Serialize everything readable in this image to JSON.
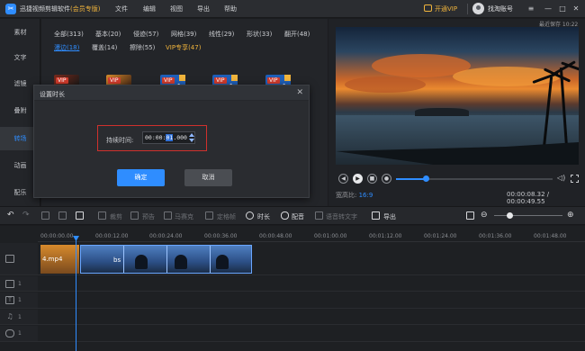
{
  "app": {
    "title_main": "迅捷视频剪辑软件",
    "title_edition": "(会员专版)",
    "menu": [
      "文件",
      "编辑",
      "视图",
      "导出",
      "帮助"
    ],
    "open_vip": "开通VIP",
    "username": "找淘账号"
  },
  "leftnav": {
    "items": [
      {
        "label": "素材"
      },
      {
        "label": "文字"
      },
      {
        "label": "滤镜"
      },
      {
        "label": "叠附"
      },
      {
        "label": "转场"
      },
      {
        "label": "动画"
      },
      {
        "label": "配乐"
      }
    ],
    "active": "转场"
  },
  "media": {
    "categories_row1": [
      "全部(313)",
      "基本(20)",
      "侵迹(57)",
      "网格(39)",
      "线性(29)",
      "形状(33)",
      "翻开(48)"
    ],
    "categories_row2": [
      "漫边(18)",
      "覆盖(14)",
      "擦除(55)",
      "VIP专享(47)"
    ],
    "vip_badge": "VIP"
  },
  "dialog": {
    "title": "设置时长",
    "duration_label": "持续时间:",
    "duration_prefix": "00:00:",
    "duration_selected": "01",
    "duration_suffix": ".000",
    "ok": "确定",
    "cancel": "取消"
  },
  "preview": {
    "latest_save": "最近保存 10:22",
    "aspect_label": "宽高比:",
    "aspect_value": "16:9",
    "time_readout": "00:00:08.32 / 00:00:49.55",
    "progress": 0.19
  },
  "toolbar": {
    "crop": "裁剪",
    "pre": "预告",
    "mosaic": "马赛克",
    "freeze": "定格帧",
    "duration": "时长",
    "dub": "配音",
    "tts": "语音转文字",
    "export": "导出",
    "zoom_level": 0.23
  },
  "timeline": {
    "ticks": [
      "00:00:00.00",
      "00:00:12.00",
      "00:00:24.00",
      "00:00:36.00",
      "00:00:48.00",
      "00:01:00.00",
      "00:01:12.00",
      "00:01:24.00",
      "00:01:36.00",
      "00:01:48.00"
    ],
    "clips": [
      {
        "label": "4.mp4"
      },
      {
        "label": "bs"
      }
    ],
    "track_subs": [
      "1",
      "1",
      "1",
      "1"
    ]
  }
}
